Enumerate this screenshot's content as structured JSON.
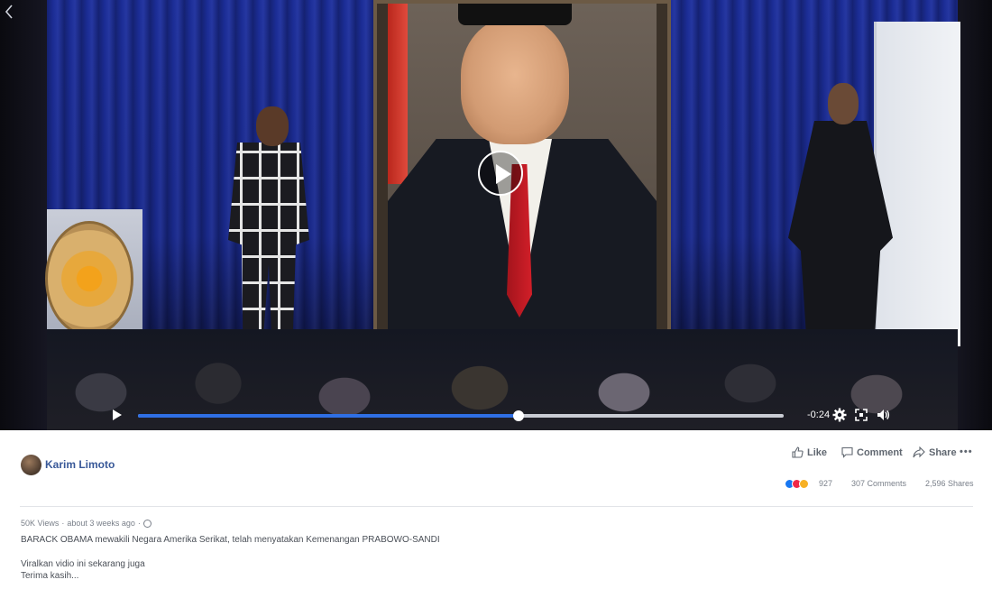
{
  "video": {
    "time_remaining": "-0:24",
    "progress": 0.59
  },
  "post": {
    "author": "Karim Limoto",
    "actions": {
      "like": "Like",
      "comment": "Comment",
      "share": "Share",
      "more": "•••"
    },
    "stats": {
      "reactions": "927",
      "comments": "307 Comments",
      "shares": "2,596 Shares"
    },
    "meta": {
      "views": "50K Views",
      "separator": "·",
      "time": "about 3 weeks ago",
      "separator2": "·"
    },
    "text_lines": [
      "BARACK OBAMA mewakili Negara Amerika Serikat, telah menyatakan Kemenangan PRABOWO-SANDI",
      "Viralkan vidio ini sekarang juga",
      "Terima kasih..."
    ]
  },
  "colors": {
    "progress_fill": "#2f6fe4",
    "author_link": "#385898",
    "reaction_like": "#1877f2",
    "reaction_love": "#f02849",
    "reaction_haha": "#f7b125"
  },
  "icons": {
    "back": "chevron-left-icon",
    "play": "play-icon",
    "settings": "gear-icon",
    "fullscreen": "expand-icon",
    "volume": "speaker-icon",
    "like": "thumbs-up-icon",
    "comment": "speech-bubble-icon",
    "share": "share-arrow-icon",
    "privacy": "globe-icon"
  }
}
